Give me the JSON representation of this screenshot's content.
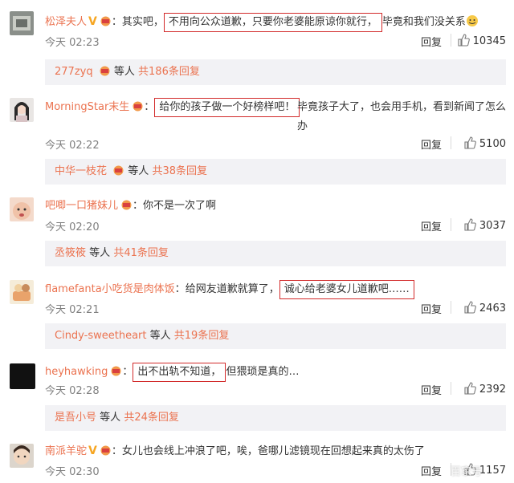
{
  "comments": [
    {
      "user": "松泽夫人",
      "verified": true,
      "text_pre": "其实吧，",
      "highlight": "不用向公众道歉，只要你老婆能原谅你就行，",
      "text_post": "毕竟和我们没关系",
      "time": "今天 02:23",
      "reply_label": "回复",
      "likes": "10345",
      "replies": {
        "user": "277zyq",
        "middle": "等人",
        "count": "共186条回复"
      }
    },
    {
      "user": "MorningStar末生",
      "verified": false,
      "text_pre": "",
      "highlight": "给你的孩子做一个好榜样吧！",
      "text_post": "毕竟孩子大了，也会用手机，看到新闻了怎么办",
      "time": "今天 02:22",
      "reply_label": "回复",
      "likes": "5100",
      "replies": {
        "user": "中华一枝花",
        "middle": "等人",
        "count": "共38条回复"
      }
    },
    {
      "user": "吧唧一口猪妹儿",
      "verified": false,
      "text_pre": "你不是一次了啊",
      "highlight": "",
      "text_post": "",
      "time": "今天 02:20",
      "reply_label": "回复",
      "likes": "3037",
      "replies": {
        "user": "丞筱筱",
        "middle": "等人",
        "count": "共41条回复"
      }
    },
    {
      "user": "flamefanta小吃货是肉体饭",
      "verified": false,
      "text_pre": "给网友道歉就算了，",
      "highlight": "诚心给老婆女儿道歉吧……",
      "text_post": "",
      "time": "今天 02:21",
      "reply_label": "回复",
      "likes": "2463",
      "replies": {
        "user": "Cindy-sweetheart",
        "middle": "等人",
        "count": "共19条回复"
      }
    },
    {
      "user": "heyhawking",
      "verified": false,
      "text_pre": "",
      "highlight": "出不出轨不知道，",
      "text_post": "但猥琐是真的…",
      "time": "今天 02:28",
      "reply_label": "回复",
      "likes": "2392",
      "replies": {
        "user": "是吾小号",
        "middle": "等人",
        "count": "共24条回复"
      }
    },
    {
      "user": "南派羊驼",
      "verified": true,
      "text_pre": "女儿也会线上冲浪了吧，唉，爸哪儿滤镜现在回想起来真的太伤了",
      "highlight": "",
      "text_post": "",
      "time": "今天 02:30",
      "reply_label": "回复",
      "likes": "1157"
    }
  ],
  "watermark": "百家号",
  "colors": {
    "username": "#eb7350",
    "highlight_border": "#d22a2a",
    "reply_bg": "#f2f2f5"
  }
}
